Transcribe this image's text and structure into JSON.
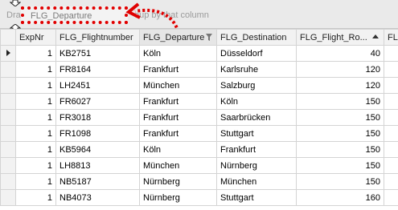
{
  "group_panel": {
    "hint": "Drag a column header here to group by that column",
    "dragged_column": "FLG_Departure"
  },
  "colors": {
    "highlight": "#e00000"
  },
  "columns": [
    {
      "label": "ExpNr"
    },
    {
      "label": "FLG_Flightnumber"
    },
    {
      "label": "FLG_Departure"
    },
    {
      "label": "FLG_Destination"
    },
    {
      "label": "FLG_Flight_Ro..."
    },
    {
      "label": "FLG_"
    }
  ],
  "rows": [
    {
      "expnr": "1",
      "flightnumber": "KB2751",
      "departure": "Köln",
      "destination": "Düsseldorf",
      "route": "40"
    },
    {
      "expnr": "1",
      "flightnumber": "FR8164",
      "departure": "Frankfurt",
      "destination": "Karlsruhe",
      "route": "120"
    },
    {
      "expnr": "1",
      "flightnumber": "LH2451",
      "departure": "München",
      "destination": "Salzburg",
      "route": "120"
    },
    {
      "expnr": "1",
      "flightnumber": "FR6027",
      "departure": "Frankfurt",
      "destination": "Köln",
      "route": "150"
    },
    {
      "expnr": "1",
      "flightnumber": "FR3018",
      "departure": "Frankfurt",
      "destination": "Saarbrücken",
      "route": "150"
    },
    {
      "expnr": "1",
      "flightnumber": "FR1098",
      "departure": "Frankfurt",
      "destination": "Stuttgart",
      "route": "150"
    },
    {
      "expnr": "1",
      "flightnumber": "KB5964",
      "departure": "Köln",
      "destination": "Frankfurt",
      "route": "150"
    },
    {
      "expnr": "1",
      "flightnumber": "LH8813",
      "departure": "München",
      "destination": "Nürnberg",
      "route": "150"
    },
    {
      "expnr": "1",
      "flightnumber": "NB5187",
      "departure": "Nürnberg",
      "destination": "München",
      "route": "150"
    },
    {
      "expnr": "1",
      "flightnumber": "NB4073",
      "departure": "Nürnberg",
      "destination": "Stuttgart",
      "route": "160"
    }
  ]
}
